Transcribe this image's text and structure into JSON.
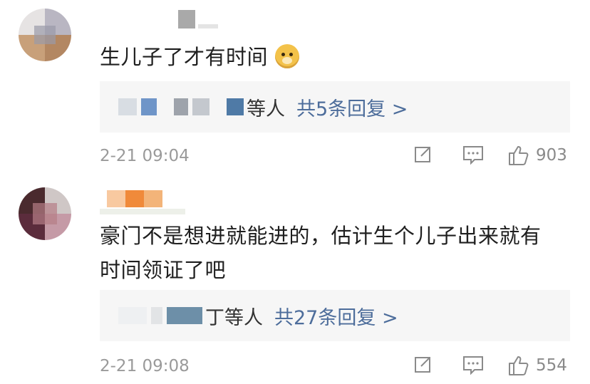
{
  "comments": [
    {
      "text": "生儿子了才有时间",
      "emoji": "doge-emoji",
      "replies_users": "等人",
      "replies_count": "共5条回复 >",
      "time": "2-21 09:04",
      "likes": "903"
    },
    {
      "text_line1": "豪门不是想进就能进的，估计生个儿子出来就有",
      "text_line2": "时间领证了吧",
      "replies_users": "丁等人",
      "replies_count": "共27条回复 >",
      "time": "2-21 09:08",
      "likes": "554"
    }
  ],
  "colors": {
    "reply_link": "#4d6d9b",
    "meta_text": "#9a9a9a",
    "reply_bg": "#f6f6f6"
  }
}
